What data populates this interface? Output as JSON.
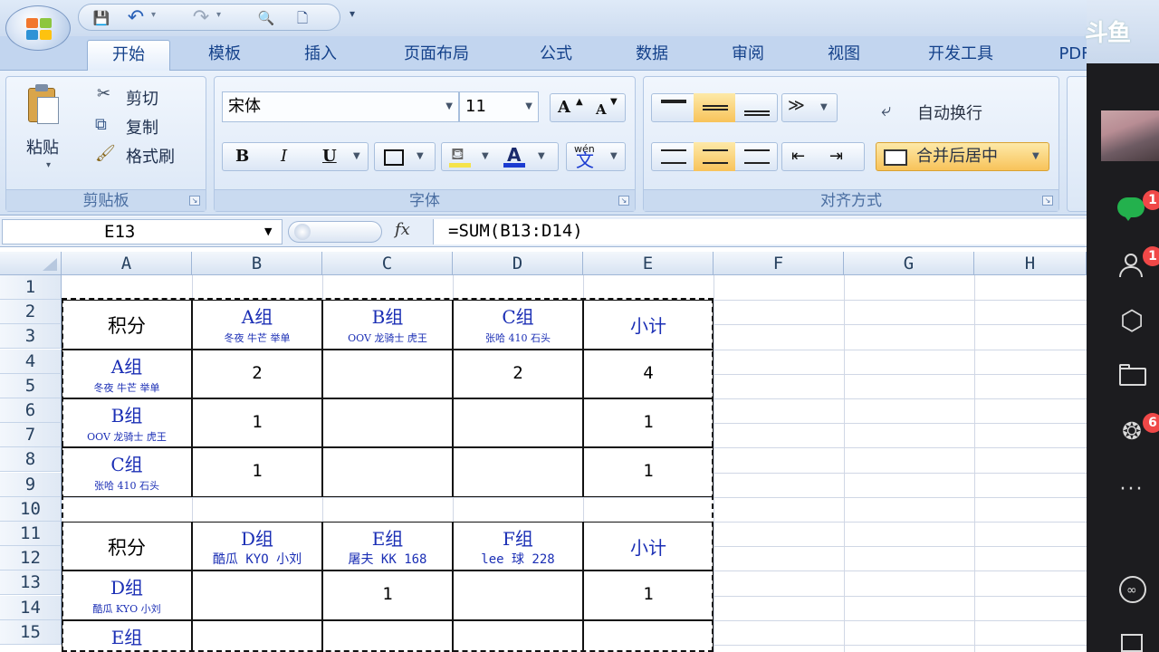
{
  "qat": {
    "save": "💾",
    "undo": "↶",
    "redo": "↷",
    "preview": "🔍",
    "new": "🗋",
    "customize": "▾"
  },
  "tabs": [
    "开始",
    "模板",
    "插入",
    "页面布局",
    "公式",
    "数据",
    "审阅",
    "视图",
    "开发工具",
    "PDF工具"
  ],
  "active_tab": "开始",
  "clipboard": {
    "paste": "粘贴",
    "cut": "剪切",
    "copy": "复制",
    "format_painter": "格式刷",
    "label": "剪贴板"
  },
  "font": {
    "name": "宋体",
    "size": "11",
    "bold": "B",
    "italic": "I",
    "underline": "U",
    "grow": "A",
    "shrink": "A",
    "color_letter": "A",
    "phonetic": "wén",
    "phonetic_char": "文",
    "label": "字体"
  },
  "alignment": {
    "wrap": "自动换行",
    "merge": "合并后居中",
    "label": "对齐方式"
  },
  "formula_bar": {
    "name_box": "E13",
    "fx": "fx",
    "formula": "=SUM(B13:D14)"
  },
  "columns": [
    "A",
    "B",
    "C",
    "D",
    "E",
    "F",
    "G",
    "H"
  ],
  "rows": [
    "1",
    "2",
    "3",
    "4",
    "5",
    "6",
    "7",
    "8",
    "9",
    "10",
    "11",
    "12",
    "13",
    "14",
    "15"
  ],
  "table1": {
    "corner": "积分",
    "headers": [
      {
        "group": "A组",
        "members": "冬夜 牛芒 举单"
      },
      {
        "group": "B组",
        "members": "OOV 龙骑士 虎王"
      },
      {
        "group": "C组",
        "members": "张哈 410 石头"
      }
    ],
    "subtotal": "小计",
    "rows": [
      {
        "group": "A组",
        "members": "冬夜 牛芒 举单",
        "values": [
          "2",
          "",
          "2"
        ],
        "total": "4"
      },
      {
        "group": "B组",
        "members": "OOV 龙骑士 虎王",
        "values": [
          "1",
          "",
          ""
        ],
        "total": "1"
      },
      {
        "group": "C组",
        "members": "张哈 410 石头",
        "values": [
          "1",
          "",
          ""
        ],
        "total": "1"
      }
    ]
  },
  "table2": {
    "corner": "积分",
    "headers": [
      {
        "group": "D组",
        "members": "酷瓜 KYO 小刘"
      },
      {
        "group": "E组",
        "members": "屠夫 KK 168"
      },
      {
        "group": "F组",
        "members": "lee 球 228"
      }
    ],
    "subtotal": "小计",
    "rows": [
      {
        "group": "D组",
        "members": "酷瓜 KYO 小刘",
        "values": [
          "",
          "1",
          ""
        ],
        "total": "1"
      },
      {
        "group": "E组",
        "members": "",
        "values": [
          "",
          "",
          ""
        ],
        "total": ""
      }
    ]
  },
  "side": {
    "logo": "斗鱼",
    "badges": [
      "1",
      "1",
      "6"
    ],
    "more": "···"
  },
  "icons": {
    "chat": "chat-icon",
    "user": "user-icon",
    "cube": "cube-icon",
    "folder": "folder-icon",
    "aperture": "aperture-icon",
    "link": "link-icon"
  }
}
